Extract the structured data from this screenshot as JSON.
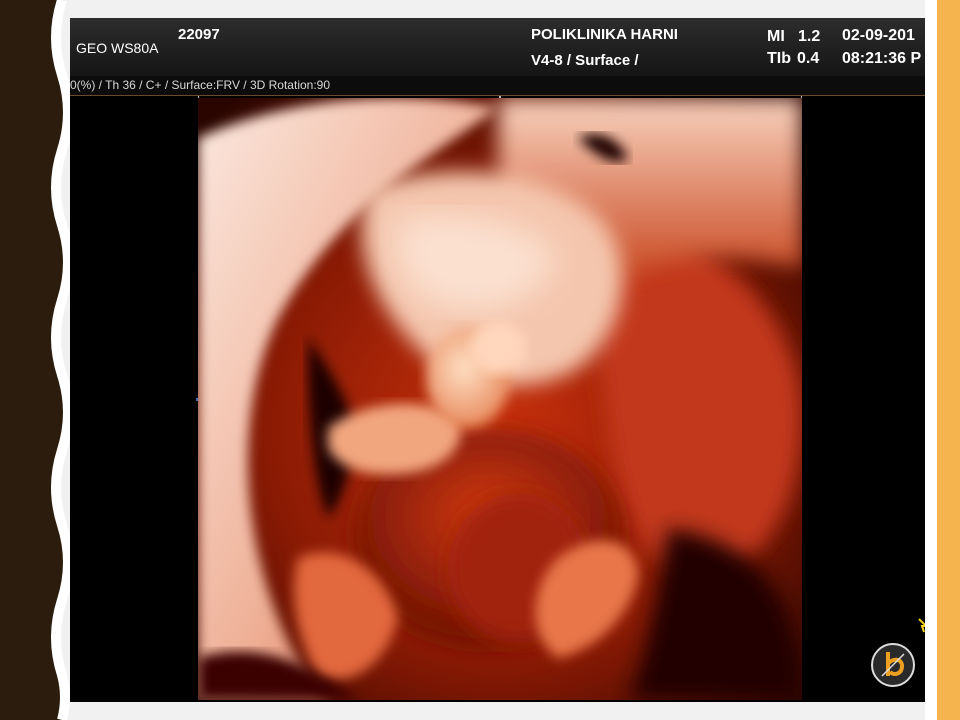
{
  "header": {
    "model": "GEO WS80A",
    "serial": "22097",
    "clinic": "POLIKLINIKA HARNI",
    "probe": "V4-8 / Surface /",
    "mi_label": "MI",
    "mi_value": "1.2",
    "tib_label": "TIb",
    "tib_value": "0.4",
    "date": "02-09-201",
    "time": "08:21:36 P"
  },
  "parameters": {
    "text": "0(%) / Th 36 / C+ / Surface:FRV / 3D Rotation:90"
  },
  "render": {
    "description_icon": "fetal-3d-ultrasound-render"
  },
  "logo": {
    "icon": "samsung-medison-logo-icon"
  },
  "colors": {
    "slide_left_border": "#2c1c0d",
    "slide_right_accent": "#f6b44e",
    "screen_background": "#000000",
    "header_text": "#ffffff",
    "render_tone": "#c0290a"
  }
}
